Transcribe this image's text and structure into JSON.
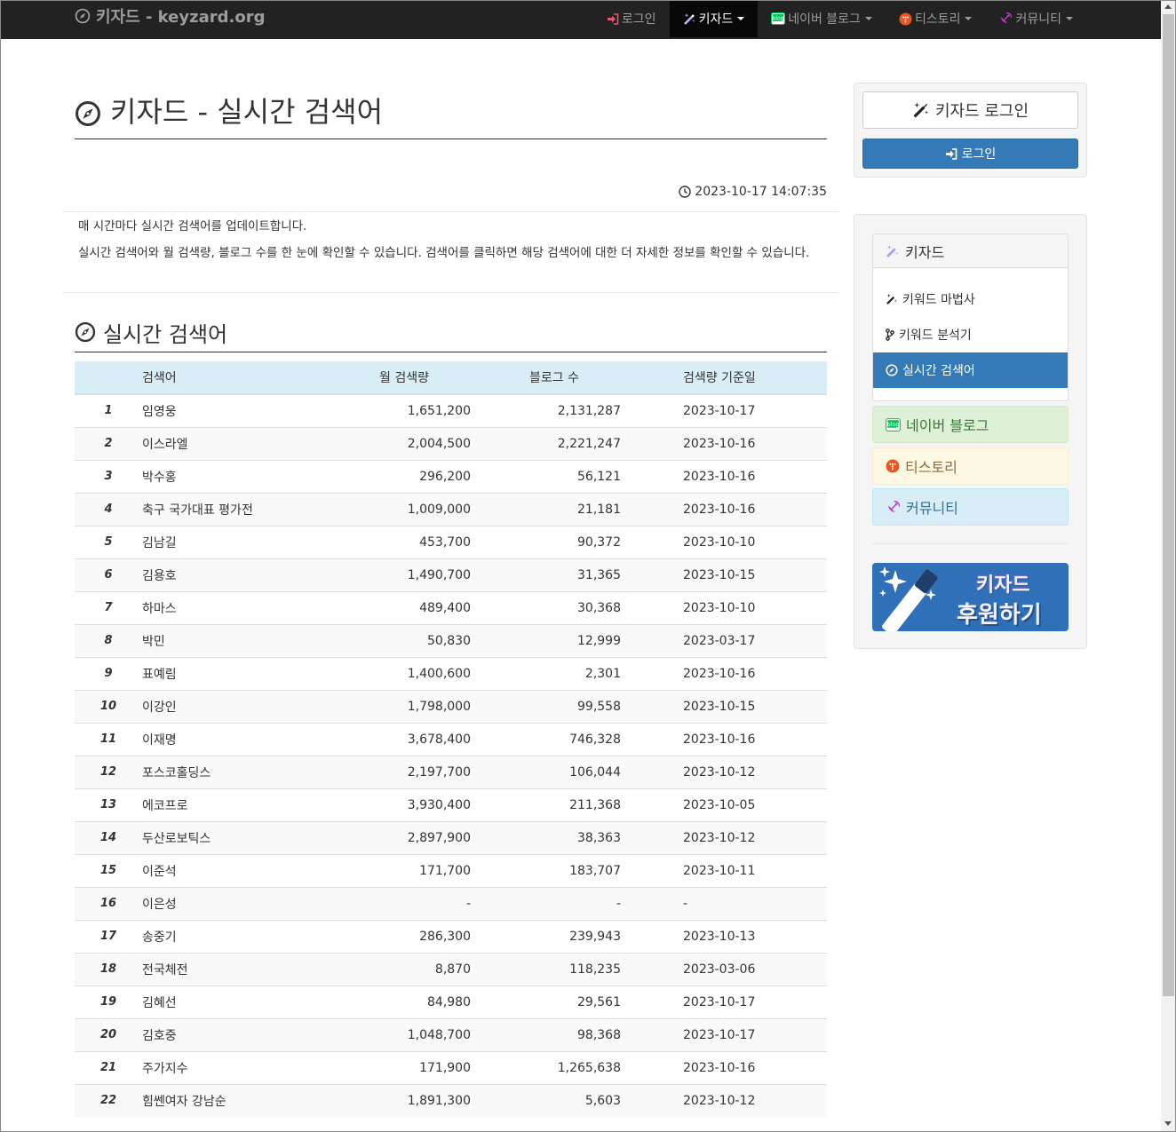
{
  "navbar": {
    "brand": "키자드 - keyzard.org",
    "items": [
      {
        "label": "로그인",
        "dropdown": false
      },
      {
        "label": "키자드",
        "dropdown": true
      },
      {
        "label": "네이버 블로그",
        "dropdown": true
      },
      {
        "label": "티스토리",
        "dropdown": true
      },
      {
        "label": "커뮤니티",
        "dropdown": true
      }
    ]
  },
  "main": {
    "title": "키자드 - 실시간 검색어",
    "timestamp": "2023-10-17 14:07:35",
    "desc1": "매 시간마다 실시간 검색어를 업데이트합니다.",
    "desc2": "실시간 검색어와 월 검색량, 블로그 수를 한 눈에 확인할 수 있습니다. 검색어를 클릭하면 해당 검색어에 대한 더 자세한 정보를 확인할 수 있습니다.",
    "section_title": "실시간 검색어",
    "columns": [
      "",
      "검색어",
      "월 검색량",
      "블로그 수",
      "검색량 기준일"
    ],
    "rows": [
      [
        "1",
        "임영웅",
        "1,651,200",
        "2,131,287",
        "2023-10-17"
      ],
      [
        "2",
        "이스라엘",
        "2,004,500",
        "2,221,247",
        "2023-10-16"
      ],
      [
        "3",
        "박수홍",
        "296,200",
        "56,121",
        "2023-10-16"
      ],
      [
        "4",
        "축구 국가대표 평가전",
        "1,009,000",
        "21,181",
        "2023-10-16"
      ],
      [
        "5",
        "김남길",
        "453,700",
        "90,372",
        "2023-10-10"
      ],
      [
        "6",
        "김용호",
        "1,490,700",
        "31,365",
        "2023-10-15"
      ],
      [
        "7",
        "하마스",
        "489,400",
        "30,368",
        "2023-10-10"
      ],
      [
        "8",
        "박민",
        "50,830",
        "12,999",
        "2023-03-17"
      ],
      [
        "9",
        "표예림",
        "1,400,600",
        "2,301",
        "2023-10-16"
      ],
      [
        "10",
        "이강인",
        "1,798,000",
        "99,558",
        "2023-10-15"
      ],
      [
        "11",
        "이재명",
        "3,678,400",
        "746,328",
        "2023-10-16"
      ],
      [
        "12",
        "포스코홀딩스",
        "2,197,700",
        "106,044",
        "2023-10-12"
      ],
      [
        "13",
        "에코프로",
        "3,930,400",
        "211,368",
        "2023-10-05"
      ],
      [
        "14",
        "두산로보틱스",
        "2,897,900",
        "38,363",
        "2023-10-12"
      ],
      [
        "15",
        "이준석",
        "171,700",
        "183,707",
        "2023-10-11"
      ],
      [
        "16",
        "이은성",
        "-",
        "-",
        "-"
      ],
      [
        "17",
        "송중기",
        "286,300",
        "239,943",
        "2023-10-13"
      ],
      [
        "18",
        "전국체전",
        "8,870",
        "118,235",
        "2023-03-06"
      ],
      [
        "19",
        "김혜선",
        "84,980",
        "29,561",
        "2023-10-17"
      ],
      [
        "20",
        "김호중",
        "1,048,700",
        "98,368",
        "2023-10-17"
      ],
      [
        "21",
        "주가지수",
        "171,900",
        "1,265,638",
        "2023-10-16"
      ],
      [
        "22",
        "힘쎈여자 강남순",
        "1,891,300",
        "5,603",
        "2023-10-12"
      ]
    ]
  },
  "sidebar": {
    "login_title": "키자드 로그인",
    "login_button": "로그인",
    "menu_heading": "키자드",
    "menu_items": [
      {
        "label": "키워드 마법사",
        "icon": "wand-icon",
        "active": false
      },
      {
        "label": "키워드 분석기",
        "icon": "branch-icon",
        "active": false
      },
      {
        "label": "실시간 검색어",
        "icon": "compass-icon",
        "active": true
      }
    ],
    "naver_blog": "네이버 블로그",
    "tistory": "티스토리",
    "community": "커뮤니티",
    "donate_line1": "키자드",
    "donate_line2": "후원하기"
  },
  "colors": {
    "navbar_bg": "#222222",
    "primary": "#337ab7",
    "table_header_bg": "#d9edf7",
    "naver_green": "#03c75a",
    "tistory_orange": "#eb531f",
    "community_magenta": "#c03cc8"
  }
}
